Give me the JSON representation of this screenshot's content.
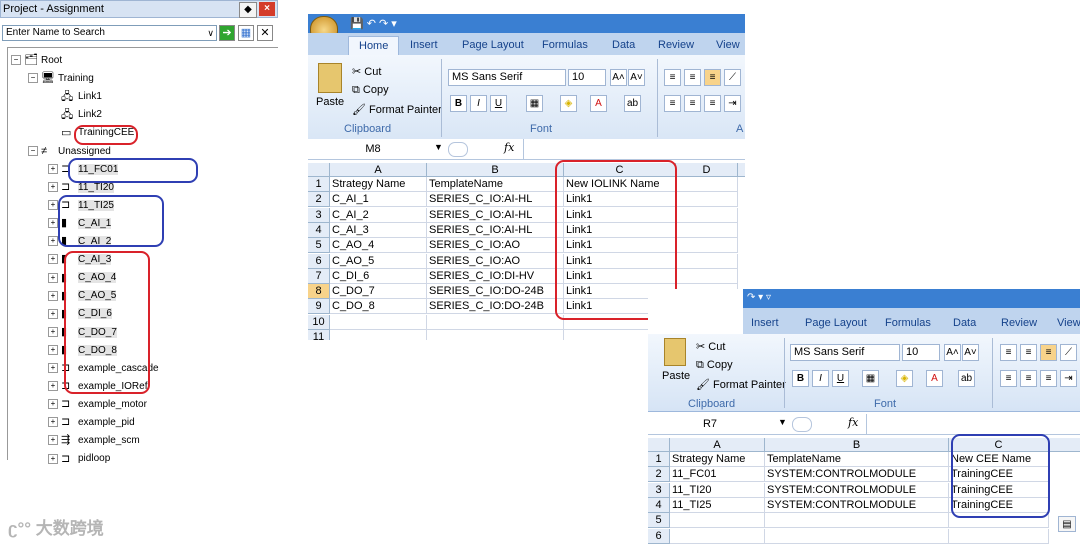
{
  "project_panel": {
    "title": "Project - Assignment",
    "search_placeholder": "Enter Name to Search",
    "tree": [
      {
        "label": "Root",
        "level": 0,
        "expander": "−"
      },
      {
        "label": "Training",
        "level": 1,
        "expander": "−"
      },
      {
        "label": "Link1",
        "level": 2,
        "expander": ""
      },
      {
        "label": "Link2",
        "level": 2,
        "expander": ""
      },
      {
        "label": "TrainingCEE",
        "level": 2,
        "expander": ""
      },
      {
        "label": "Unassigned",
        "level": 1,
        "expander": "−"
      },
      {
        "label": "11_FC01",
        "level": 2,
        "expander": "+"
      },
      {
        "label": "11_TI20",
        "level": 2,
        "expander": "+"
      },
      {
        "label": "11_TI25",
        "level": 2,
        "expander": "+"
      },
      {
        "label": "C_AI_1",
        "level": 2,
        "expander": "+"
      },
      {
        "label": "C_AI_2",
        "level": 2,
        "expander": "+"
      },
      {
        "label": "C_AI_3",
        "level": 2,
        "expander": "+"
      },
      {
        "label": "C_AO_4",
        "level": 2,
        "expander": "+"
      },
      {
        "label": "C_AO_5",
        "level": 2,
        "expander": "+"
      },
      {
        "label": "C_DI_6",
        "level": 2,
        "expander": "+"
      },
      {
        "label": "C_DO_7",
        "level": 2,
        "expander": "+"
      },
      {
        "label": "C_DO_8",
        "level": 2,
        "expander": "+"
      },
      {
        "label": "example_cascade",
        "level": 2,
        "expander": "+"
      },
      {
        "label": "example_IORef",
        "level": 2,
        "expander": "+"
      },
      {
        "label": "example_motor",
        "level": 2,
        "expander": "+"
      },
      {
        "label": "example_pid",
        "level": 2,
        "expander": "+"
      },
      {
        "label": "example_scm",
        "level": 2,
        "expander": "+"
      },
      {
        "label": "pidloop",
        "level": 2,
        "expander": "+"
      }
    ]
  },
  "excel1": {
    "tabs": [
      "Home",
      "Insert",
      "Page Layout",
      "Formulas",
      "Data",
      "Review",
      "View"
    ],
    "clipboard": {
      "cut": "Cut",
      "copy": "Copy",
      "paste": "Paste",
      "format_painter": "Format Painter",
      "group": "Clipboard"
    },
    "font": {
      "name": "MS Sans Serif",
      "size": "10",
      "group": "Font"
    },
    "group_partial": "A",
    "name_box": "M8",
    "fx": "fx",
    "columns": [
      "A",
      "B",
      "C",
      "D"
    ],
    "rows": [
      [
        "1",
        "Strategy Name",
        "TemplateName",
        "New IOLINK Name"
      ],
      [
        "2",
        "C_AI_1",
        "SERIES_C_IO:AI-HL",
        "Link1"
      ],
      [
        "3",
        "C_AI_2",
        "SERIES_C_IO:AI-HL",
        "Link1"
      ],
      [
        "4",
        "C_AI_3",
        "SERIES_C_IO:AI-HL",
        "Link1"
      ],
      [
        "5",
        "C_AO_4",
        "SERIES_C_IO:AO",
        "Link1"
      ],
      [
        "6",
        "C_AO_5",
        "SERIES_C_IO:AO",
        "Link1"
      ],
      [
        "7",
        "C_DI_6",
        "SERIES_C_IO:DI-HV",
        "Link1"
      ],
      [
        "8",
        "C_DO_7",
        "SERIES_C_IO:DO-24B",
        "Link1"
      ],
      [
        "9",
        "C_DO_8",
        "SERIES_C_IO:DO-24B",
        "Link1"
      ],
      [
        "10",
        "",
        "",
        ""
      ],
      [
        "11",
        "",
        "",
        ""
      ]
    ]
  },
  "excel2": {
    "tabs": [
      "Insert",
      "Page Layout",
      "Formulas",
      "Data",
      "Review",
      "View"
    ],
    "clipboard": {
      "cut": "Cut",
      "copy": "Copy",
      "paste": "Paste",
      "format_painter": "Format Painter",
      "group": "Clipboard"
    },
    "font": {
      "name": "MS Sans Serif",
      "size": "10",
      "group": "Font"
    },
    "name_box": "R7",
    "fx": "fx",
    "columns": [
      "A",
      "B",
      "C"
    ],
    "rows": [
      [
        "1",
        "Strategy Name",
        "TemplateName",
        "New CEE Name"
      ],
      [
        "2",
        "11_FC01",
        "SYSTEM:CONTROLMODULE",
        "TrainingCEE"
      ],
      [
        "3",
        "11_TI20",
        "SYSTEM:CONTROLMODULE",
        "TrainingCEE"
      ],
      [
        "4",
        "11_TI25",
        "SYSTEM:CONTROLMODULE",
        "TrainingCEE"
      ],
      [
        "5",
        "",
        "",
        ""
      ],
      [
        "6",
        "",
        "",
        ""
      ]
    ]
  },
  "watermark": "大数跨境"
}
